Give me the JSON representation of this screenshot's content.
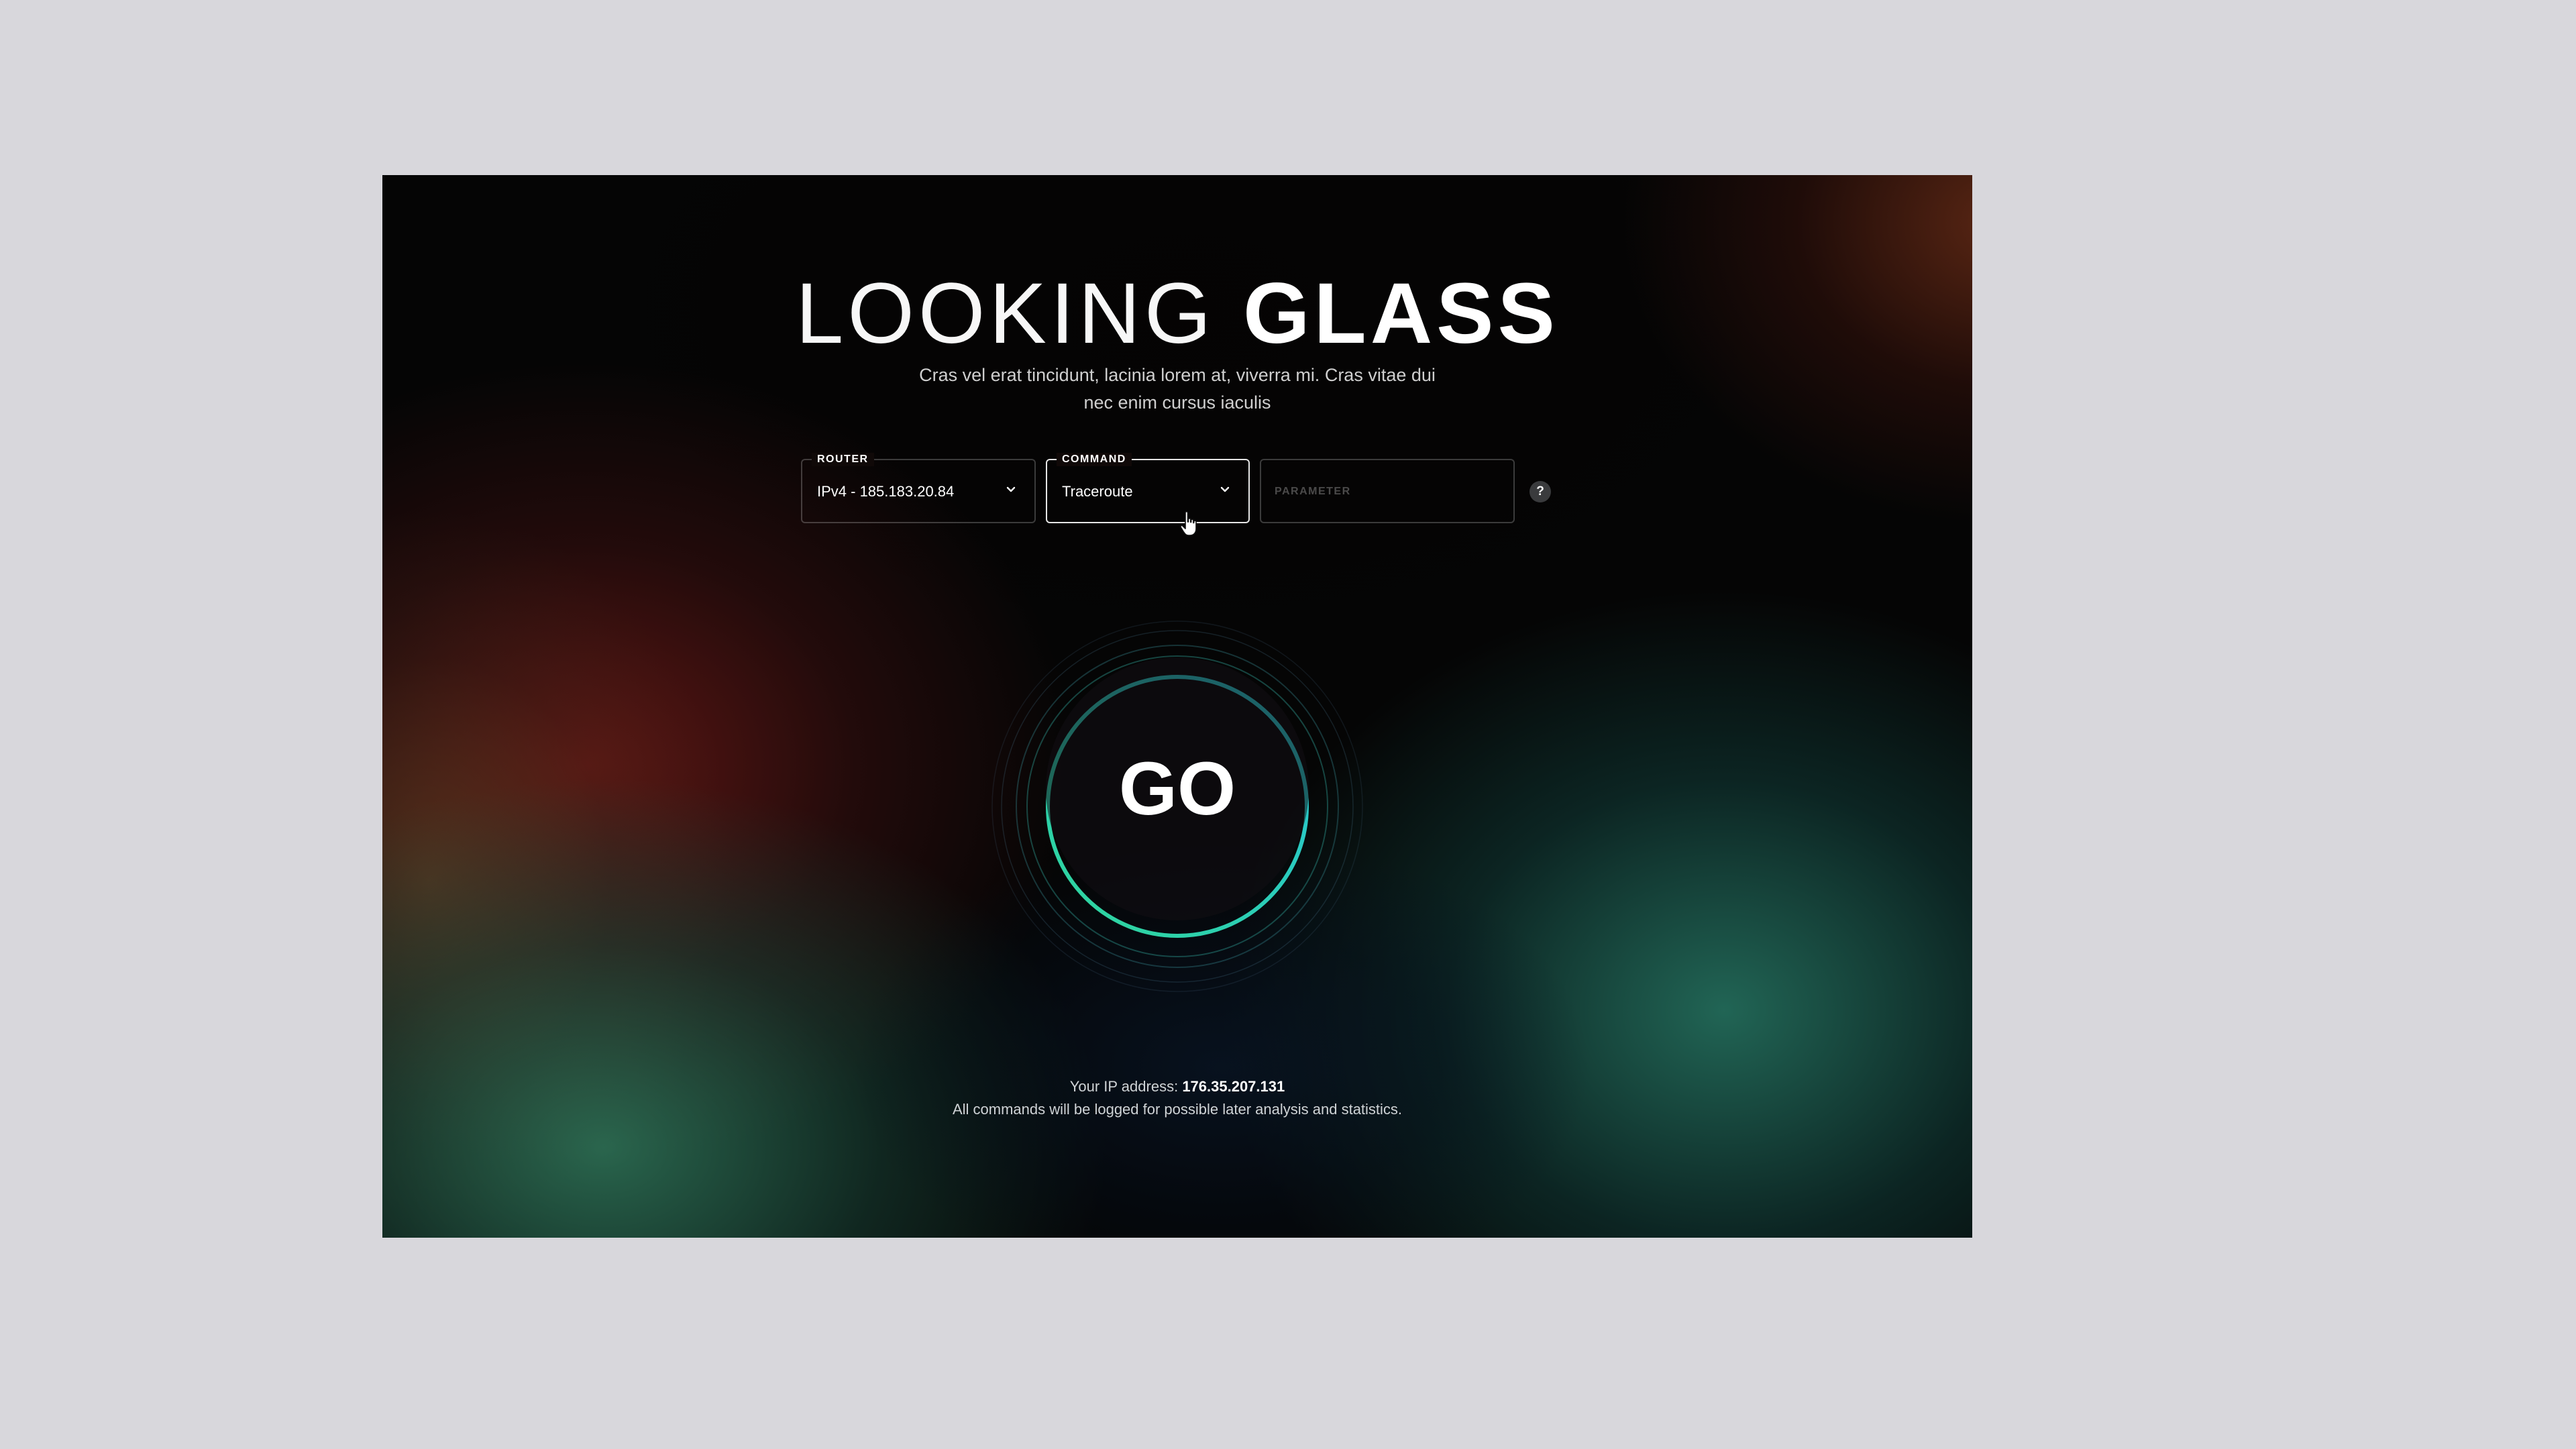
{
  "header": {
    "title_light": "LOOKING",
    "title_bold": "GLASS",
    "subtitle_line1": "Cras vel erat tincidunt, lacinia lorem at, viverra mi. Cras vitae dui",
    "subtitle_line2": "nec enim cursus iaculis"
  },
  "form": {
    "router": {
      "label": "ROUTER",
      "value": "IPv4 - 185.183.20.84"
    },
    "command": {
      "label": "COMMAND",
      "value": "Traceroute"
    },
    "parameter": {
      "placeholder": "PARAMETER",
      "value": ""
    },
    "help_label": "?"
  },
  "go_button": {
    "label": "GO"
  },
  "footer": {
    "ip_prefix": "Your IP address:",
    "ip_value": "176.35.207.131",
    "log_notice": "All commands will be logged for possible later analysis and statistics."
  },
  "colors": {
    "page_background": "#d8d7dc",
    "panel_background": "#050505",
    "ring_green": "#2fd69a",
    "ring_cyan": "#27c4d6"
  },
  "icons": {
    "router_chevron": "chevron-down-icon",
    "command_chevron": "chevron-down-icon",
    "help": "question-icon",
    "cursor": "hand-pointer-icon"
  }
}
